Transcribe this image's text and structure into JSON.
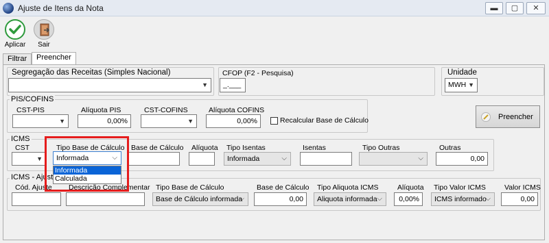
{
  "window": {
    "title": "Ajuste de Itens da Nota",
    "minimize_glyph": "▬",
    "maximize_glyph": "▢",
    "close_glyph": "✕",
    "icon": "app-globe-icon"
  },
  "toolbar": {
    "apply_label": "Aplicar",
    "exit_label": "Sair",
    "apply_icon": "checkmark-icon",
    "exit_icon": "door-exit-icon"
  },
  "tabs": [
    {
      "label": "Filtrar"
    },
    {
      "label": "Preencher"
    }
  ],
  "top_row": {
    "segregacao_label": "Segregação das Receitas (Simples Nacional)",
    "segregacao_value": "",
    "cfop_label": "CFOP (F2 - Pesquisa)",
    "cfop_value": "_.___",
    "unidade_label": "Unidade",
    "unidade_value": "MWH"
  },
  "pis_cofins": {
    "group_label": "PIS/COFINS",
    "cst_pis_label": "CST-PIS",
    "cst_pis_value": "",
    "aliquota_pis_label": "Alíquota PIS",
    "aliquota_pis_value": "0,00%",
    "cst_cofins_label": "CST-COFINS",
    "cst_cofins_value": "",
    "aliquota_cofins_label": "Alíquota COFINS",
    "aliquota_cofins_value": "0,00%",
    "recalcular_label": "Recalcular Base de Cálculo",
    "recalcular_checked": false
  },
  "preencher_button": {
    "label": "Preencher",
    "icon": "pencil-icon"
  },
  "icms": {
    "group_label": "ICMS",
    "cst_label": "CST",
    "cst_value": "",
    "tipo_base_label": "Tipo Base de Cálculo",
    "tipo_base_value": "Informada",
    "tipo_base_options": [
      "Informada",
      "Calculada"
    ],
    "base_calculo_label": "Base de Cálculo",
    "base_calculo_value": "",
    "aliquota_label": "Alíquota",
    "aliquota_value": "",
    "tipo_isentas_label": "Tipo Isentas",
    "tipo_isentas_value": "Informada",
    "isentas_label": "Isentas",
    "isentas_value": "",
    "tipo_outras_label": "Tipo Outras",
    "tipo_outras_value": "",
    "outras_label": "Outras",
    "outras_value": "0,00"
  },
  "icms_ajuste": {
    "group_label": "ICMS - Ajuste",
    "cod_ajuste_label": "Cód. Ajuste",
    "cod_ajuste_value": "",
    "descricao_label": "Descrição Complementar",
    "descricao_value": "",
    "tipo_base_label": "Tipo Base de Cálculo",
    "tipo_base_value": "Base de Cálculo informada",
    "base_calculo_label": "Base de Cálculo",
    "base_calculo_value": "0,00",
    "tipo_aliquota_label": "Tipo Aliquota ICMS",
    "tipo_aliquota_value": "Aliquota informada",
    "aliquota_label": "Alíquota",
    "aliquota_value": "0,00%",
    "tipo_valor_label": "Tipo Valor ICMS",
    "tipo_valor_value": "ICMS informado",
    "valor_label": "Valor ICMS",
    "valor_value": "0,00"
  },
  "colors": {
    "highlight_border": "#e51c1c",
    "selected_option": "#0a64d7",
    "apply_green": "#2e9a3c"
  }
}
